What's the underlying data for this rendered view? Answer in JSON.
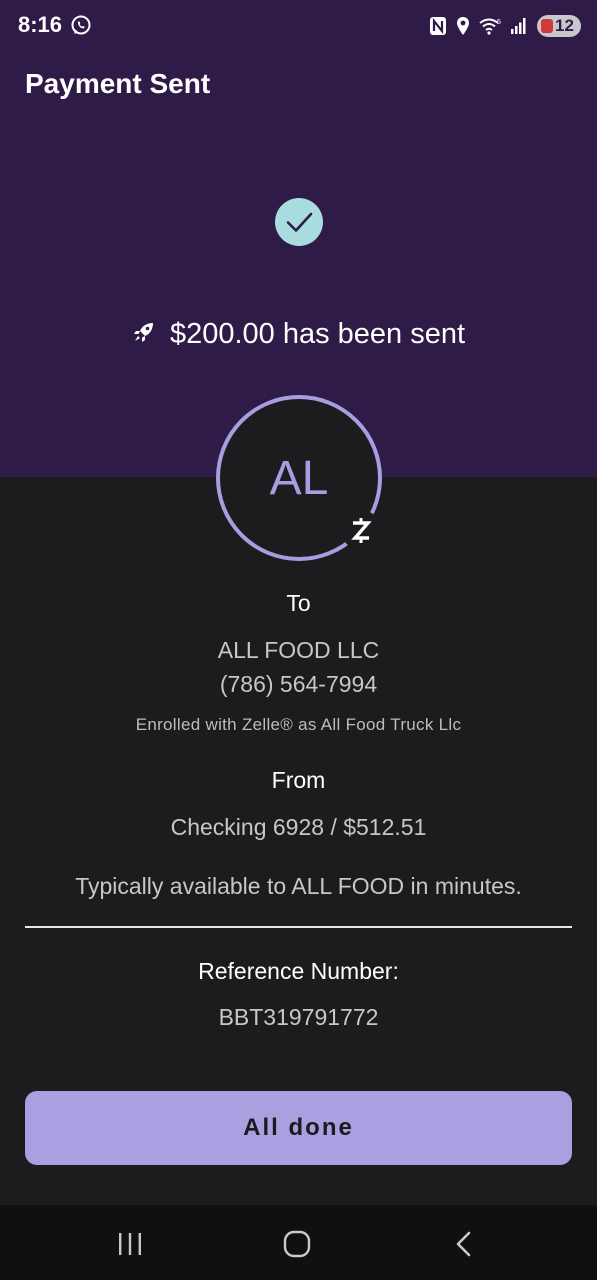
{
  "status_bar": {
    "time": "8:16",
    "battery_level": "12",
    "icons": [
      "whatsapp-icon",
      "nfc-icon",
      "location-icon",
      "wifi-icon",
      "signal-icon",
      "battery-icon"
    ]
  },
  "header": {
    "title": "Payment Sent"
  },
  "confirmation": {
    "amount_message": "$200.00 has been sent",
    "icons": [
      "checkmark-icon",
      "rocket-icon"
    ]
  },
  "recipient": {
    "initials": "AL",
    "to_label": "To",
    "name": "ALL FOOD LLC",
    "phone": "(786) 564-7994",
    "enrolled_text": "Enrolled with Zelle® as All Food Truck Llc",
    "badge_icon": "zelle-icon"
  },
  "sender": {
    "from_label": "From",
    "account": "Checking 6928 / $512.51"
  },
  "availability_text": "Typically available to ALL FOOD in minutes.",
  "reference": {
    "label": "Reference Number:",
    "value": "BBT319791772"
  },
  "actions": {
    "done_label": "All done"
  },
  "nav_bar": {
    "buttons": [
      "recents-icon",
      "home-icon",
      "back-icon"
    ]
  },
  "colors": {
    "header_bg": "#2e1b48",
    "body_bg": "#1c1c1e",
    "accent": "#a89de0",
    "button_bg": "#a8a0e0",
    "check_bg": "#a8dcdf"
  }
}
